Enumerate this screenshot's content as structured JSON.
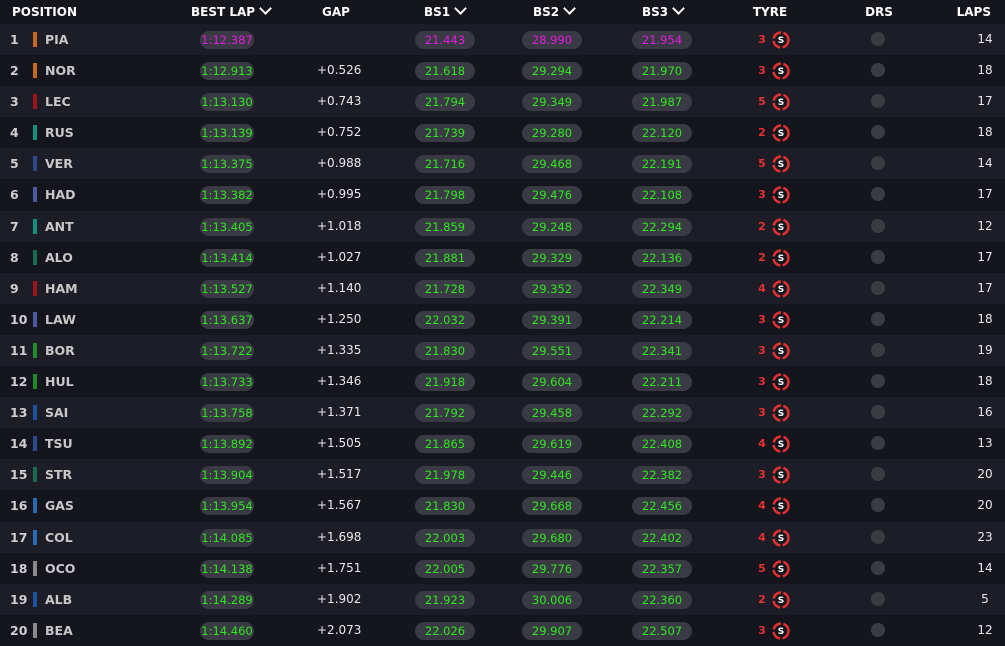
{
  "headers": {
    "position": "POSITION",
    "best_lap": "BEST LAP",
    "gap": "GAP",
    "bs1": "BS1",
    "bs2": "BS2",
    "bs3": "BS3",
    "tyre": "TYRE",
    "drs": "DRS",
    "laps": "LAPS"
  },
  "colors": {
    "personal_best": "#2ee81e",
    "overall_best": "#e318e3",
    "tyre_soft": "#e8302f",
    "drs_off": "#3b3b43"
  },
  "tyre_icon": "soft-tyre-icon",
  "rows": [
    {
      "pos": "1",
      "code": "PIA",
      "team_color": "#c8681a",
      "best": "1:12.387",
      "best_color": "#e318e3",
      "gap": "",
      "bs1": "21.443",
      "bs1_color": "#e318e3",
      "bs2": "28.990",
      "bs2_color": "#e318e3",
      "bs3": "21.954",
      "bs3_color": "#e318e3",
      "tyre_age": "3",
      "laps": "14"
    },
    {
      "pos": "2",
      "code": "NOR",
      "team_color": "#c8681a",
      "best": "1:12.913",
      "best_color": "#2ee81e",
      "gap": "+0.526",
      "bs1": "21.618",
      "bs1_color": "#2ee81e",
      "bs2": "29.294",
      "bs2_color": "#2ee81e",
      "bs3": "21.970",
      "bs3_color": "#2ee81e",
      "tyre_age": "3",
      "laps": "18"
    },
    {
      "pos": "3",
      "code": "LEC",
      "team_color": "#a0121b",
      "best": "1:13.130",
      "best_color": "#2ee81e",
      "gap": "+0.743",
      "bs1": "21.794",
      "bs1_color": "#2ee81e",
      "bs2": "29.349",
      "bs2_color": "#2ee81e",
      "bs3": "21.987",
      "bs3_color": "#2ee81e",
      "tyre_age": "5",
      "laps": "17"
    },
    {
      "pos": "4",
      "code": "RUS",
      "team_color": "#12907a",
      "best": "1:13.139",
      "best_color": "#2ee81e",
      "gap": "+0.752",
      "bs1": "21.739",
      "bs1_color": "#2ee81e",
      "bs2": "29.280",
      "bs2_color": "#2ee81e",
      "bs3": "22.120",
      "bs3_color": "#2ee81e",
      "tyre_age": "2",
      "laps": "18"
    },
    {
      "pos": "5",
      "code": "VER",
      "team_color": "#2a4a8c",
      "best": "1:13.375",
      "best_color": "#2ee81e",
      "gap": "+0.988",
      "bs1": "21.716",
      "bs1_color": "#2ee81e",
      "bs2": "29.468",
      "bs2_color": "#2ee81e",
      "bs3": "22.191",
      "bs3_color": "#2ee81e",
      "tyre_age": "5",
      "laps": "14"
    },
    {
      "pos": "6",
      "code": "HAD",
      "team_color": "#4a5aa0",
      "best": "1:13.382",
      "best_color": "#2ee81e",
      "gap": "+0.995",
      "bs1": "21.798",
      "bs1_color": "#2ee81e",
      "bs2": "29.476",
      "bs2_color": "#2ee81e",
      "bs3": "22.108",
      "bs3_color": "#2ee81e",
      "tyre_age": "3",
      "laps": "17"
    },
    {
      "pos": "7",
      "code": "ANT",
      "team_color": "#12907a",
      "best": "1:13.405",
      "best_color": "#2ee81e",
      "gap": "+1.018",
      "bs1": "21.859",
      "bs1_color": "#2ee81e",
      "bs2": "29.248",
      "bs2_color": "#2ee81e",
      "bs3": "22.294",
      "bs3_color": "#2ee81e",
      "tyre_age": "2",
      "laps": "12"
    },
    {
      "pos": "8",
      "code": "ALO",
      "team_color": "#1a6a50",
      "best": "1:13.414",
      "best_color": "#2ee81e",
      "gap": "+1.027",
      "bs1": "21.881",
      "bs1_color": "#2ee81e",
      "bs2": "29.329",
      "bs2_color": "#2ee81e",
      "bs3": "22.136",
      "bs3_color": "#2ee81e",
      "tyre_age": "2",
      "laps": "17"
    },
    {
      "pos": "9",
      "code": "HAM",
      "team_color": "#a0121b",
      "best": "1:13.527",
      "best_color": "#2ee81e",
      "gap": "+1.140",
      "bs1": "21.728",
      "bs1_color": "#2ee81e",
      "bs2": "29.352",
      "bs2_color": "#2ee81e",
      "bs3": "22.349",
      "bs3_color": "#2ee81e",
      "tyre_age": "4",
      "laps": "17"
    },
    {
      "pos": "10",
      "code": "LAW",
      "team_color": "#4a5aa0",
      "best": "1:13.637",
      "best_color": "#2ee81e",
      "gap": "+1.250",
      "bs1": "22.032",
      "bs1_color": "#2ee81e",
      "bs2": "29.391",
      "bs2_color": "#2ee81e",
      "bs3": "22.214",
      "bs3_color": "#2ee81e",
      "tyre_age": "3",
      "laps": "18"
    },
    {
      "pos": "11",
      "code": "BOR",
      "team_color": "#1e8a2a",
      "best": "1:13.722",
      "best_color": "#2ee81e",
      "gap": "+1.335",
      "bs1": "21.830",
      "bs1_color": "#2ee81e",
      "bs2": "29.551",
      "bs2_color": "#2ee81e",
      "bs3": "22.341",
      "bs3_color": "#2ee81e",
      "tyre_age": "3",
      "laps": "19"
    },
    {
      "pos": "12",
      "code": "HUL",
      "team_color": "#1e8a2a",
      "best": "1:13.733",
      "best_color": "#2ee81e",
      "gap": "+1.346",
      "bs1": "21.918",
      "bs1_color": "#2ee81e",
      "bs2": "29.604",
      "bs2_color": "#2ee81e",
      "bs3": "22.211",
      "bs3_color": "#2ee81e",
      "tyre_age": "3",
      "laps": "18"
    },
    {
      "pos": "13",
      "code": "SAI",
      "team_color": "#1f4fa0",
      "best": "1:13.758",
      "best_color": "#2ee81e",
      "gap": "+1.371",
      "bs1": "21.792",
      "bs1_color": "#2ee81e",
      "bs2": "29.458",
      "bs2_color": "#2ee81e",
      "bs3": "22.292",
      "bs3_color": "#2ee81e",
      "tyre_age": "3",
      "laps": "16"
    },
    {
      "pos": "14",
      "code": "TSU",
      "team_color": "#2a4a8c",
      "best": "1:13.892",
      "best_color": "#2ee81e",
      "gap": "+1.505",
      "bs1": "21.865",
      "bs1_color": "#2ee81e",
      "bs2": "29.619",
      "bs2_color": "#2ee81e",
      "bs3": "22.408",
      "bs3_color": "#2ee81e",
      "tyre_age": "4",
      "laps": "13"
    },
    {
      "pos": "15",
      "code": "STR",
      "team_color": "#1a6a50",
      "best": "1:13.904",
      "best_color": "#2ee81e",
      "gap": "+1.517",
      "bs1": "21.978",
      "bs1_color": "#2ee81e",
      "bs2": "29.446",
      "bs2_color": "#2ee81e",
      "bs3": "22.382",
      "bs3_color": "#2ee81e",
      "tyre_age": "3",
      "laps": "20"
    },
    {
      "pos": "16",
      "code": "GAS",
      "team_color": "#2a6ab0",
      "best": "1:13.954",
      "best_color": "#2ee81e",
      "gap": "+1.567",
      "bs1": "21.830",
      "bs1_color": "#2ee81e",
      "bs2": "29.668",
      "bs2_color": "#2ee81e",
      "bs3": "22.456",
      "bs3_color": "#2ee81e",
      "tyre_age": "4",
      "laps": "20"
    },
    {
      "pos": "17",
      "code": "COL",
      "team_color": "#2a6ab0",
      "best": "1:14.085",
      "best_color": "#2ee81e",
      "gap": "+1.698",
      "bs1": "22.003",
      "bs1_color": "#2ee81e",
      "bs2": "29.680",
      "bs2_color": "#2ee81e",
      "bs3": "22.402",
      "bs3_color": "#2ee81e",
      "tyre_age": "4",
      "laps": "23"
    },
    {
      "pos": "18",
      "code": "OCO",
      "team_color": "#8a8a8a",
      "best": "1:14.138",
      "best_color": "#2ee81e",
      "gap": "+1.751",
      "bs1": "22.005",
      "bs1_color": "#2ee81e",
      "bs2": "29.776",
      "bs2_color": "#2ee81e",
      "bs3": "22.357",
      "bs3_color": "#2ee81e",
      "tyre_age": "5",
      "laps": "14"
    },
    {
      "pos": "19",
      "code": "ALB",
      "team_color": "#1f4fa0",
      "best": "1:14.289",
      "best_color": "#2ee81e",
      "gap": "+1.902",
      "bs1": "21.923",
      "bs1_color": "#2ee81e",
      "bs2": "30.006",
      "bs2_color": "#2ee81e",
      "bs3": "22.360",
      "bs3_color": "#2ee81e",
      "tyre_age": "2",
      "laps": "5"
    },
    {
      "pos": "20",
      "code": "BEA",
      "team_color": "#8a8a8a",
      "best": "1:14.460",
      "best_color": "#2ee81e",
      "gap": "+2.073",
      "bs1": "22.026",
      "bs1_color": "#2ee81e",
      "bs2": "29.907",
      "bs2_color": "#2ee81e",
      "bs3": "22.507",
      "bs3_color": "#2ee81e",
      "tyre_age": "3",
      "laps": "12"
    }
  ]
}
